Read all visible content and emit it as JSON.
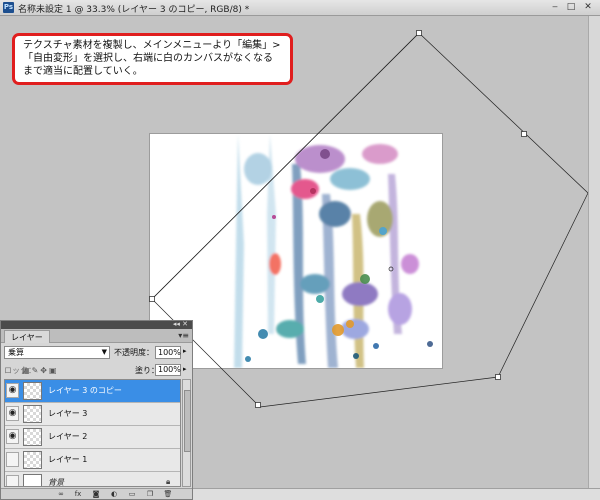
{
  "window": {
    "title": "名称未設定 1 @ 33.3% (レイヤー 3 のコピー, RGB/8) *",
    "app_icon": "Ps",
    "minimize_icon": "minimize-icon",
    "maximize_icon": "maximize-icon",
    "close_icon": "close-icon"
  },
  "callout": {
    "lines": [
      "テクスチャ素材を複製し、メインメニューより「編集」>",
      "「自由変形」を選択し、右端に白のカンバスがなくなる",
      "まで適当に配置していく。"
    ],
    "border_color": "#e01e1e"
  },
  "layers_panel": {
    "tab_label": "レイヤー",
    "menu_glyph": "▾≡",
    "blend_mode": "乗算",
    "opacity_label": "不透明度：",
    "opacity_value": "100%",
    "lock_label": "ロック：",
    "fill_label": "塗り：",
    "fill_value": "100%",
    "layers": [
      {
        "name": "レイヤー 3 のコピー",
        "visible": true,
        "selected": true,
        "thumb": "transparent"
      },
      {
        "name": "レイヤー 3",
        "visible": true,
        "selected": false,
        "thumb": "transparent"
      },
      {
        "name": "レイヤー 2",
        "visible": true,
        "selected": false,
        "thumb": "transparent"
      },
      {
        "name": "レイヤー 1",
        "visible": false,
        "selected": false,
        "thumb": "transparent"
      },
      {
        "name": "背景",
        "visible": false,
        "selected": false,
        "thumb": "white",
        "locked": true
      }
    ],
    "footer_icons": [
      "link-icon",
      "fx-icon",
      "mask-icon",
      "adjustment-icon",
      "group-icon",
      "new-layer-icon",
      "trash-icon"
    ],
    "selection_color": "#3a8ee6"
  }
}
